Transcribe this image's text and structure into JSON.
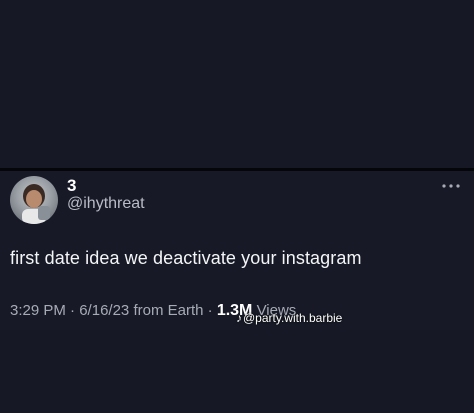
{
  "tweet": {
    "display_name": "3",
    "handle": "@ihythreat",
    "text": "first date idea we deactivate your instagram",
    "time": "3:29 PM",
    "date": "6/16/23",
    "source": "from Earth",
    "views_count": "1.3M",
    "views_label": "Views",
    "more_icon": "more-horizontal-icon"
  },
  "watermark": {
    "icon": "tiktok-icon",
    "text": "@party.with.barbie"
  },
  "colors": {
    "background": "#171a26",
    "text_primary": "#ffffff",
    "text_secondary": "#a7abb6"
  }
}
